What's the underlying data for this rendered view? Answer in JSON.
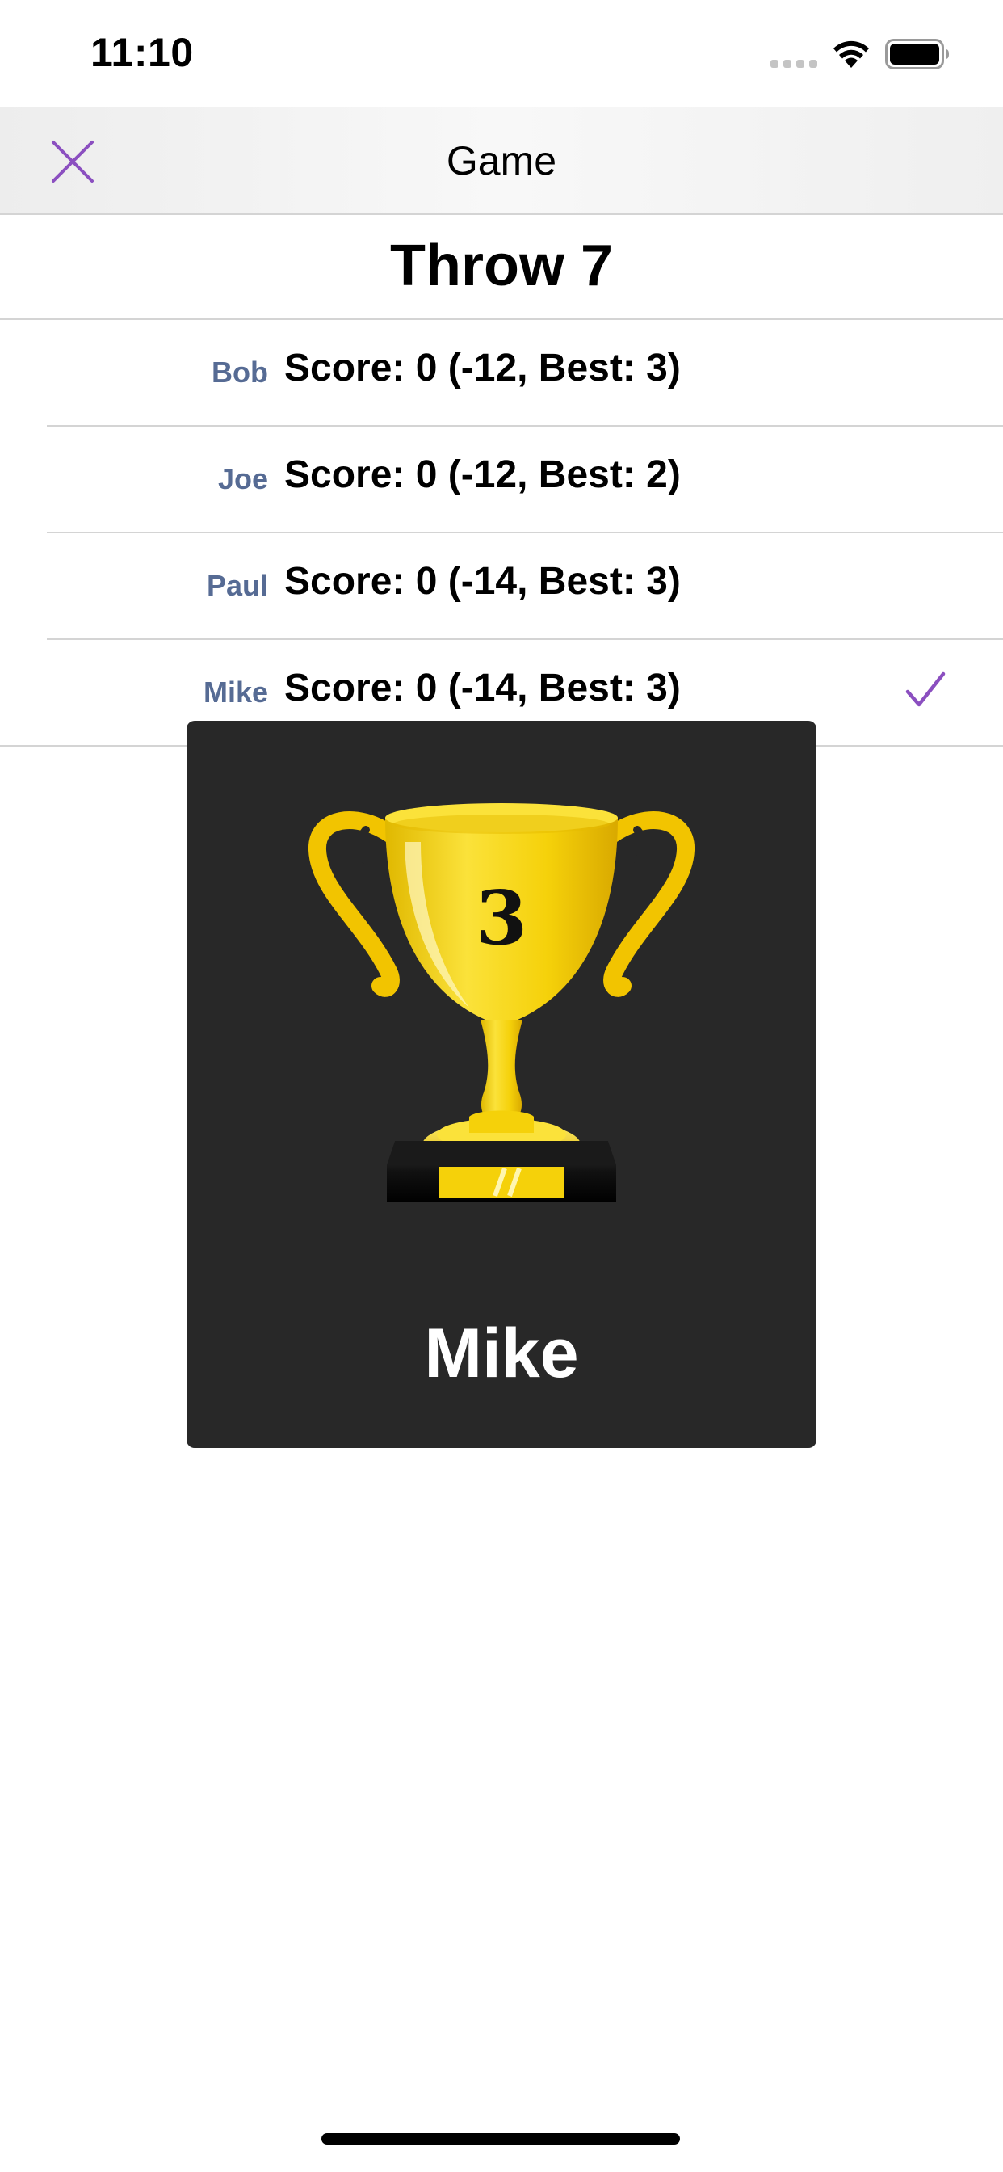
{
  "status_bar": {
    "time": "11:10",
    "icons": [
      "signal-icon",
      "wifi-icon",
      "battery-icon"
    ]
  },
  "nav": {
    "title": "Game",
    "close_icon": "close-icon",
    "accent_color": "#8b4fc0"
  },
  "throw": {
    "title": "Throw 7"
  },
  "players": [
    {
      "name": "Bob",
      "score": "Score: 0 (-12, Best: 3)",
      "selected": false
    },
    {
      "name": "Joe",
      "score": "Score: 0 (-12, Best: 2)",
      "selected": false
    },
    {
      "name": "Paul",
      "score": "Score: 0 (-14, Best: 3)",
      "selected": false
    },
    {
      "name": "Mike",
      "score": "Score: 0 (-14, Best: 3)",
      "selected": true
    }
  ],
  "trophy": {
    "number": "3",
    "winner": "Mike",
    "icon": "trophy-icon",
    "gold_color": "#f5d10a"
  },
  "colors": {
    "name_color": "#566b94",
    "card_background": "#282828"
  }
}
